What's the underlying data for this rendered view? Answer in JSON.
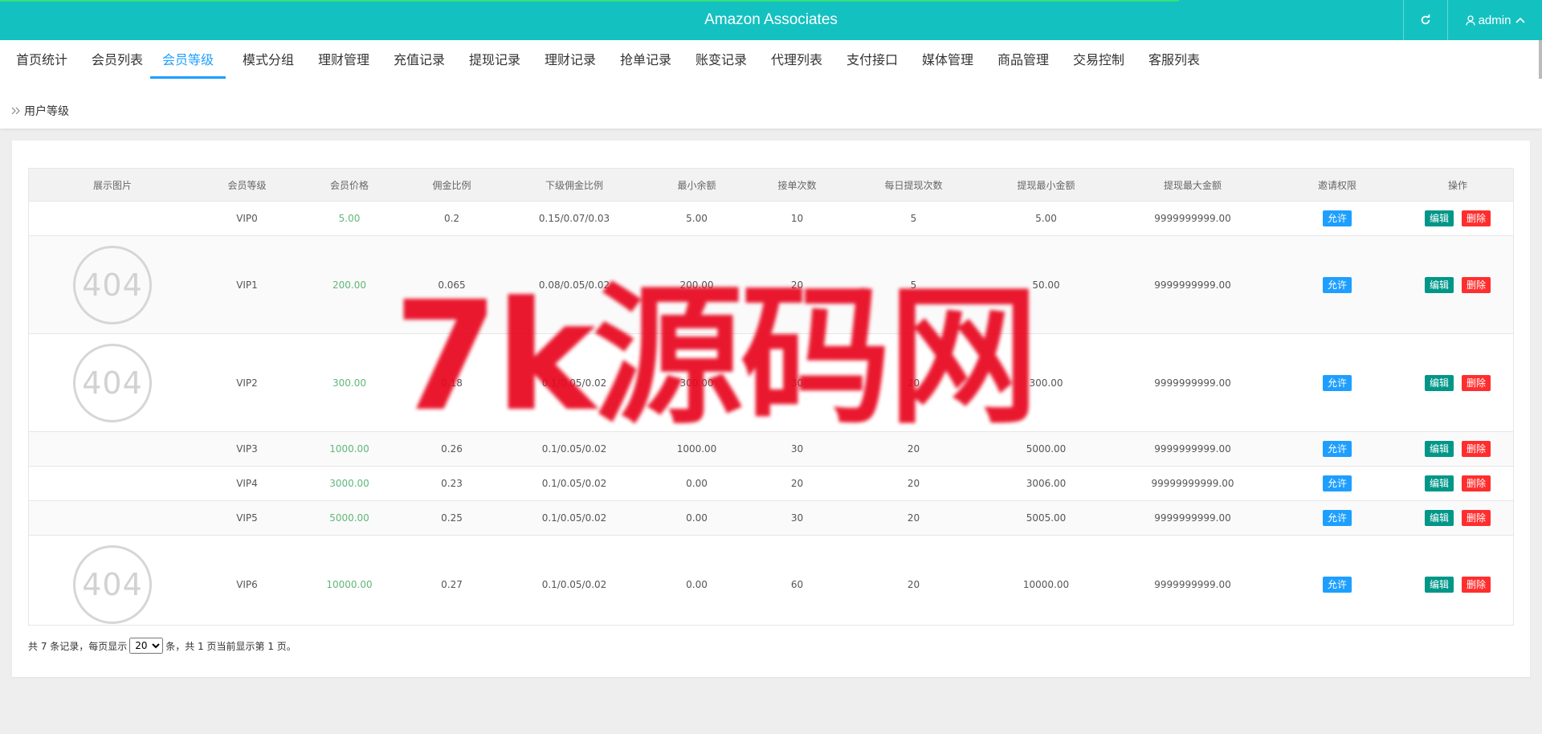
{
  "header": {
    "title": "Amazon Associates",
    "user": "admin"
  },
  "nav": {
    "tabs": [
      "首页统计",
      "会员列表",
      "会员等级",
      "模式分组",
      "理财管理",
      "充值记录",
      "提现记录",
      "理财记录",
      "抢单记录",
      "账变记录",
      "代理列表",
      "支付接口",
      "媒体管理",
      "商品管理",
      "交易控制",
      "客服列表"
    ],
    "active": 2
  },
  "breadcrumb": "用户等级",
  "table": {
    "columns": [
      "展示图片",
      "会员等级",
      "会员价格",
      "佣金比例",
      "下级佣金比例",
      "最小余额",
      "接单次数",
      "每日提现次数",
      "提现最小金额",
      "提现最大金额",
      "邀请权限",
      "操作"
    ],
    "image_placeholder": "404",
    "rows": [
      {
        "level": "VIP0",
        "price": "5.00",
        "rate": "0.2",
        "sub_rate": "0.15/0.07/0.03",
        "min_balance": "5.00",
        "orders": "10",
        "daily_withdraw": "5",
        "withdraw_min": "5.00",
        "withdraw_max": "9999999999.00",
        "invite": "允许",
        "has_image": false
      },
      {
        "level": "VIP1",
        "price": "200.00",
        "rate": "0.065",
        "sub_rate": "0.08/0.05/0.02",
        "min_balance": "200.00",
        "orders": "20",
        "daily_withdraw": "5",
        "withdraw_min": "50.00",
        "withdraw_max": "9999999999.00",
        "invite": "允许",
        "has_image": true
      },
      {
        "level": "VIP2",
        "price": "300.00",
        "rate": "0.18",
        "sub_rate": "0.1/0.05/0.02",
        "min_balance": "300.00",
        "orders": "30",
        "daily_withdraw": "20",
        "withdraw_min": "300.00",
        "withdraw_max": "9999999999.00",
        "invite": "允许",
        "has_image": true
      },
      {
        "level": "VIP3",
        "price": "1000.00",
        "rate": "0.26",
        "sub_rate": "0.1/0.05/0.02",
        "min_balance": "1000.00",
        "orders": "30",
        "daily_withdraw": "20",
        "withdraw_min": "5000.00",
        "withdraw_max": "9999999999.00",
        "invite": "允许",
        "has_image": false
      },
      {
        "level": "VIP4",
        "price": "3000.00",
        "rate": "0.23",
        "sub_rate": "0.1/0.05/0.02",
        "min_balance": "0.00",
        "orders": "20",
        "daily_withdraw": "20",
        "withdraw_min": "3006.00",
        "withdraw_max": "99999999999.00",
        "invite": "允许",
        "has_image": false
      },
      {
        "level": "VIP5",
        "price": "5000.00",
        "rate": "0.25",
        "sub_rate": "0.1/0.05/0.02",
        "min_balance": "0.00",
        "orders": "30",
        "daily_withdraw": "20",
        "withdraw_min": "5005.00",
        "withdraw_max": "9999999999.00",
        "invite": "允许",
        "has_image": false
      },
      {
        "level": "VIP6",
        "price": "10000.00",
        "rate": "0.27",
        "sub_rate": "0.1/0.05/0.02",
        "min_balance": "0.00",
        "orders": "60",
        "daily_withdraw": "20",
        "withdraw_min": "10000.00",
        "withdraw_max": "9999999999.00",
        "invite": "允许",
        "has_image": true
      }
    ],
    "edit_label": "编辑",
    "delete_label": "删除"
  },
  "pager": {
    "prefix": "共 7 条记录，每页显示",
    "page_size": "20",
    "suffix": "条，共 1 页当前显示第 1 页。"
  },
  "watermark": "7k源码网",
  "colors": {
    "topbar": "#14c1c1",
    "accent": "#1e9fff",
    "price": "#5fb878",
    "edit": "#009688",
    "delete": "#ff2e2e",
    "watermark": "#e8071f"
  }
}
